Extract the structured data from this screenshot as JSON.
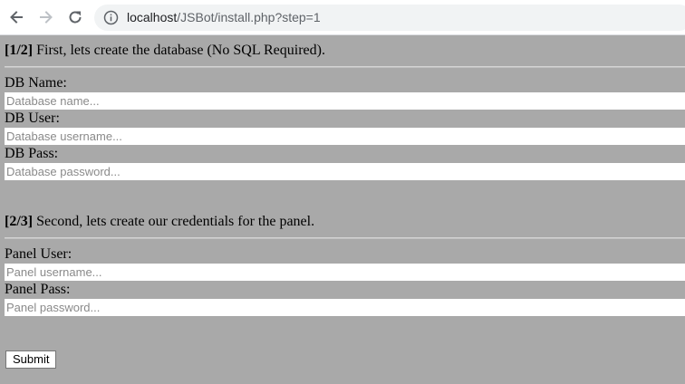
{
  "browser": {
    "url_host": "localhost",
    "url_path": "/JSBot/install.php?step=1"
  },
  "step1": {
    "tag": "[1/2]",
    "text": " First, lets create the database (No SQL Required).",
    "fields": [
      {
        "label": "DB Name:",
        "placeholder": "Database name...",
        "value": ""
      },
      {
        "label": "DB User:",
        "placeholder": "Database username...",
        "value": ""
      },
      {
        "label": "DB Pass:",
        "placeholder": "Database password...",
        "value": ""
      }
    ]
  },
  "step2": {
    "tag": "[2/3]",
    "text": " Second, lets create our credentials for the panel.",
    "fields": [
      {
        "label": "Panel User:",
        "placeholder": "Panel username...",
        "value": ""
      },
      {
        "label": "Panel Pass:",
        "placeholder": "Panel password...",
        "value": ""
      }
    ]
  },
  "submit_label": "Submit"
}
